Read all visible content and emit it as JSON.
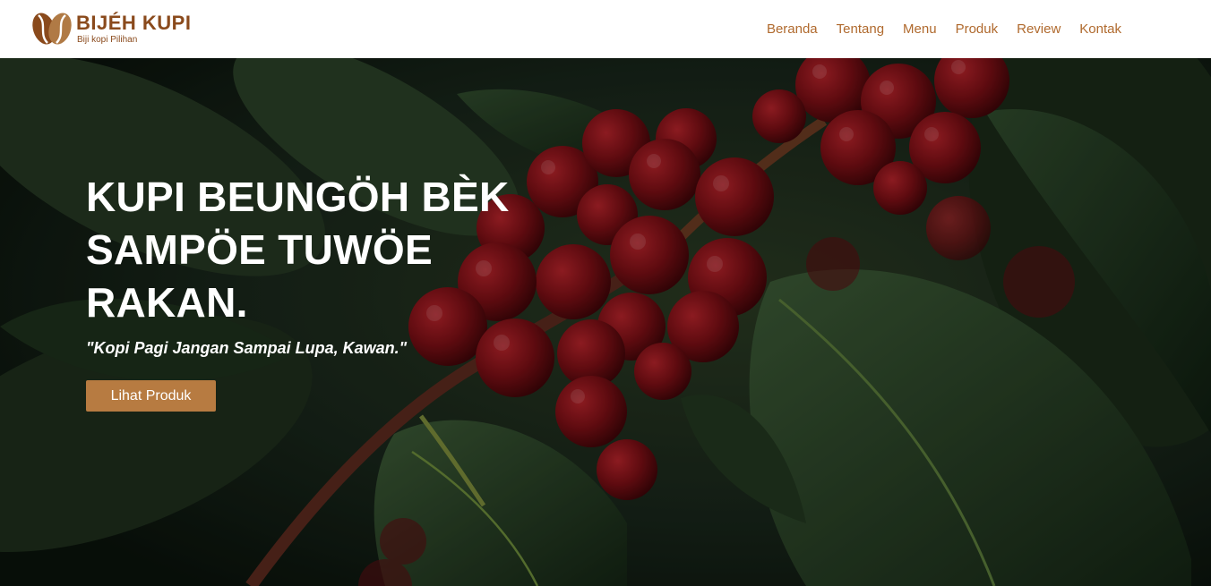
{
  "brand": {
    "name": "BIJÉH KUPI",
    "tagline": "Biji kopi Pilihan",
    "logo_icon": "coffee-bean-icon",
    "color": "#8a4a1c"
  },
  "nav": {
    "items": [
      {
        "label": "Beranda"
      },
      {
        "label": "Tentang"
      },
      {
        "label": "Menu"
      },
      {
        "label": "Produk"
      },
      {
        "label": "Review"
      },
      {
        "label": "Kontak"
      }
    ],
    "link_color": "#b06a2e"
  },
  "hero": {
    "title_lines": [
      "KUPI BEUNGÖH BÈK",
      "SAMPÖE TUWÖE",
      "RAKAN."
    ],
    "quote": "\"Kopi Pagi Jangan Sampai Lupa, Kawan.\"",
    "button_label": "Lihat Produk",
    "button_color": "#b77b41",
    "background": "coffee-cherries-photo"
  }
}
